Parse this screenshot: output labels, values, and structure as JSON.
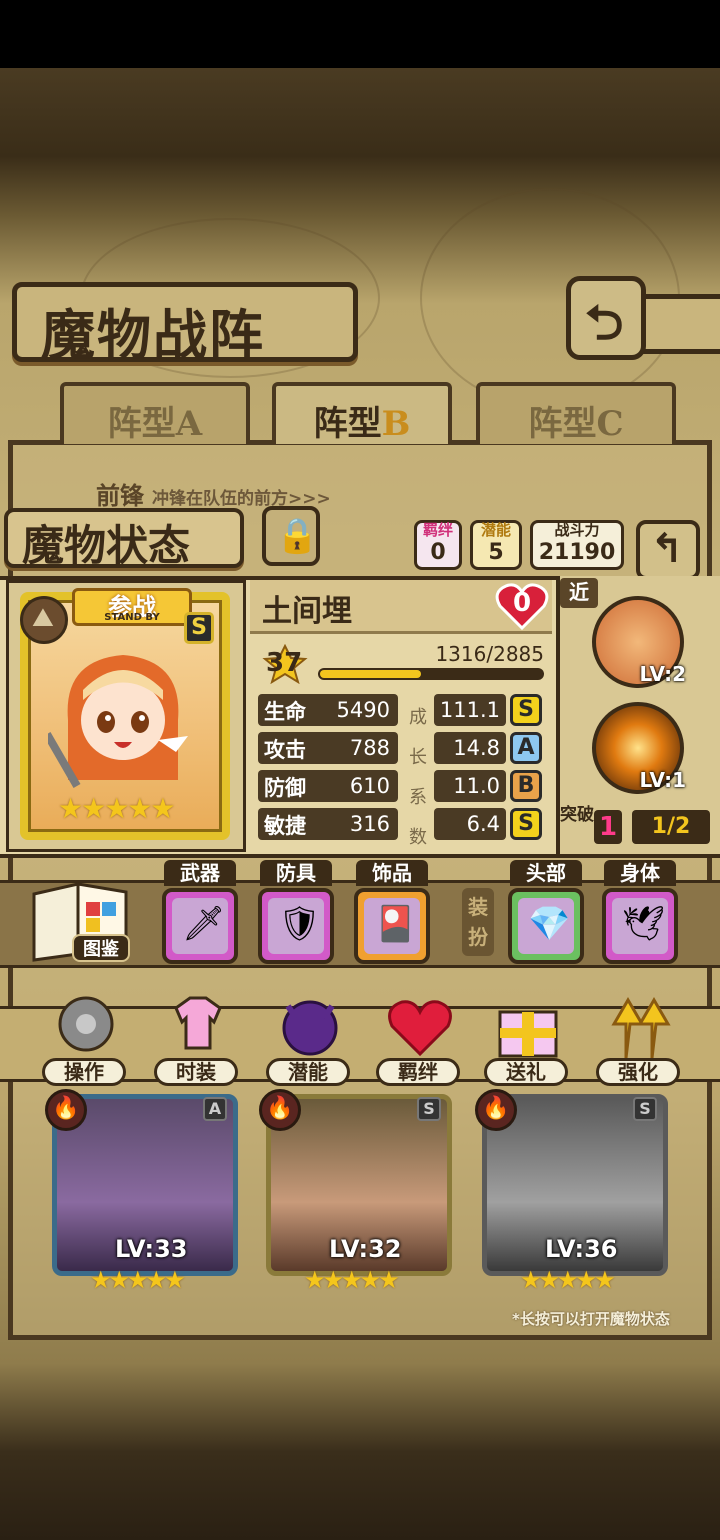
{
  "screen": {
    "title": "魔物战阵",
    "tabs": [
      {
        "prefix": "阵型",
        "suffix": "A",
        "active": false
      },
      {
        "prefix": "阵型",
        "suffix": "B",
        "active": true
      },
      {
        "prefix": "阵型",
        "suffix": "C",
        "active": false
      }
    ],
    "front_row": {
      "label": "前锋",
      "desc": "冲锋在队伍的前方>>>"
    }
  },
  "status": {
    "banner": "魔物状态",
    "bond": {
      "label": "羁绊",
      "value": "0"
    },
    "potential": {
      "label": "潜能",
      "value": "5"
    },
    "power": {
      "label": "战斗力",
      "value": "21190"
    }
  },
  "monster": {
    "standby_cn": "参战",
    "standby_en": "STAND BY",
    "rank": "S",
    "stars": "★★★★★",
    "name": "土间埋",
    "affection": "0",
    "level": "37",
    "exp_text": "1316/2885",
    "exp_fraction": 0.456,
    "growth_label": "成长系数",
    "stats": [
      {
        "key": "生命",
        "value": "5490",
        "growth": "111.1",
        "grade": "S",
        "grade_color": "#f3d21c"
      },
      {
        "key": "攻击",
        "value": "788",
        "growth": "14.8",
        "grade": "A",
        "grade_color": "#8ec8f0"
      },
      {
        "key": "防御",
        "value": "610",
        "growth": "11.0",
        "grade": "B",
        "grade_color": "#e9a24a"
      },
      {
        "key": "敏捷",
        "value": "316",
        "growth": "6.4",
        "grade": "S",
        "grade_color": "#f3d21c"
      }
    ]
  },
  "skills": {
    "range_tag": "近",
    "items": [
      {
        "name": "bread-skill-icon",
        "lv": "LV:2"
      },
      {
        "name": "slash-skill-icon",
        "lv": "LV:1"
      }
    ],
    "breakthrough_label": "突破",
    "breakthrough_level": "1",
    "breakthrough_count": "1/2"
  },
  "equipment": {
    "book_label": "图鉴",
    "dress_label": "装扮",
    "slots": [
      {
        "label": "武器",
        "icon": "sword-icon",
        "glyph": "🗡",
        "color": "#d25ac8"
      },
      {
        "label": "防具",
        "icon": "armor-icon",
        "glyph": "🛡",
        "color": "#d25ac8"
      },
      {
        "label": "饰品",
        "icon": "card-accessory-icon",
        "glyph": "🎴",
        "color": "#f0a030"
      },
      {
        "label": "头部",
        "icon": "diamond-icon",
        "glyph": "💎",
        "color": "#6bc060"
      },
      {
        "label": "身体",
        "icon": "dove-icon",
        "glyph": "🕊",
        "color": "#d25ac8"
      }
    ]
  },
  "menu": [
    {
      "label": "操作",
      "icon": "gear-icon"
    },
    {
      "label": "时装",
      "icon": "outfit-icon"
    },
    {
      "label": "潜能",
      "icon": "demon-icon"
    },
    {
      "label": "羁绊",
      "icon": "hearts-icon"
    },
    {
      "label": "送礼",
      "icon": "gift-icon"
    },
    {
      "label": "强化",
      "icon": "upgrade-arrows-icon"
    }
  ],
  "roster": [
    {
      "lv": "LV:33",
      "grade": "A",
      "stars": "★★★★★"
    },
    {
      "lv": "LV:32",
      "grade": "S",
      "stars": "★★★★★"
    },
    {
      "lv": "LV:36",
      "grade": "S",
      "stars": "★★★★★"
    }
  ],
  "hint": "*长按可以打开魔物状态"
}
